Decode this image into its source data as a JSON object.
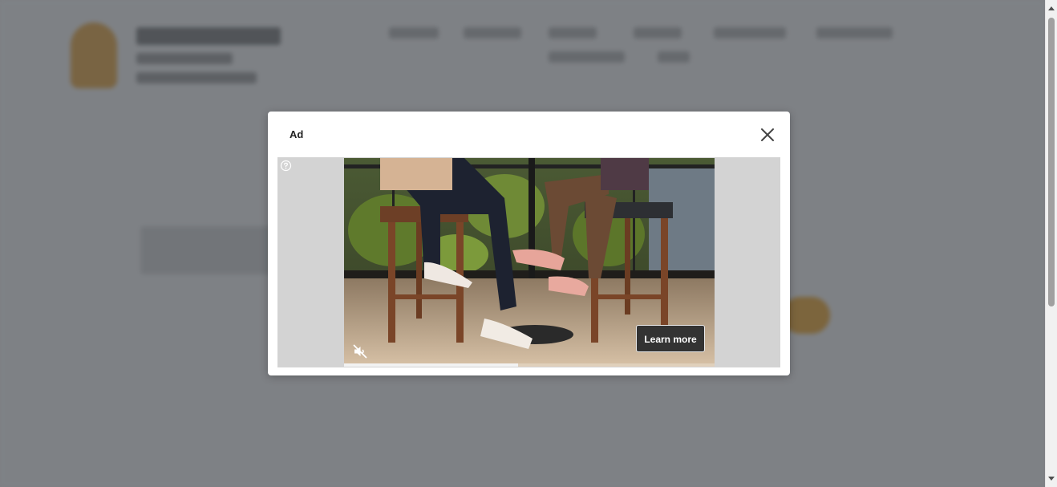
{
  "modal": {
    "ad_label": "Ad",
    "close_icon": "close-icon",
    "help_icon": "question-circle-icon",
    "mute_icon": "volume-off-icon",
    "learn_more_label": "Learn more",
    "video_progress": 0.47
  }
}
